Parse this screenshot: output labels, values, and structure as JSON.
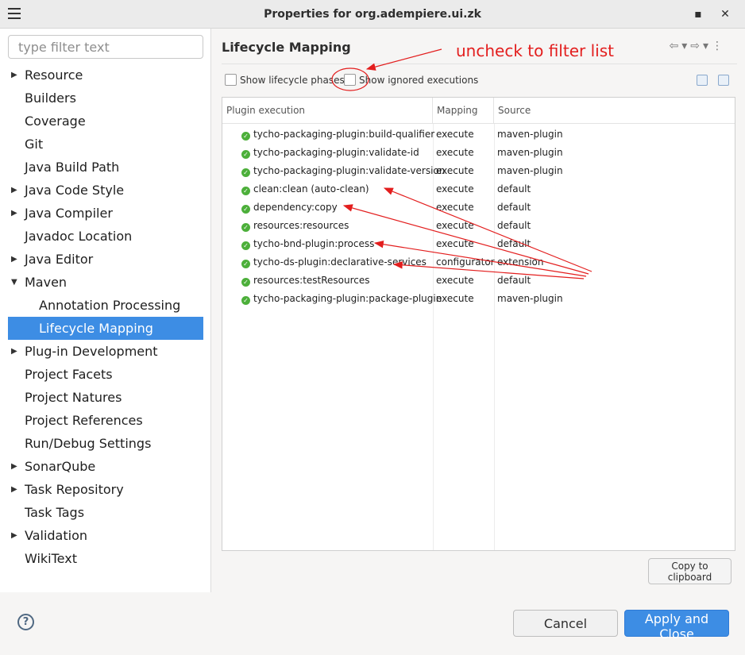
{
  "window": {
    "title": "Properties for org.adempiere.ui.zk"
  },
  "filter": {
    "placeholder": "type filter text"
  },
  "tree": {
    "items": [
      {
        "label": "Resource",
        "arrow": "right",
        "indent": 0
      },
      {
        "label": "Builders",
        "arrow": "",
        "indent": 0
      },
      {
        "label": "Coverage",
        "arrow": "",
        "indent": 0
      },
      {
        "label": "Git",
        "arrow": "",
        "indent": 0
      },
      {
        "label": "Java Build Path",
        "arrow": "",
        "indent": 0
      },
      {
        "label": "Java Code Style",
        "arrow": "right",
        "indent": 0
      },
      {
        "label": "Java Compiler",
        "arrow": "right",
        "indent": 0
      },
      {
        "label": "Javadoc Location",
        "arrow": "",
        "indent": 0
      },
      {
        "label": "Java Editor",
        "arrow": "right",
        "indent": 0
      },
      {
        "label": "Maven",
        "arrow": "down",
        "indent": 0
      },
      {
        "label": "Annotation Processing",
        "arrow": "",
        "indent": 1
      },
      {
        "label": "Lifecycle Mapping",
        "arrow": "",
        "indent": 1,
        "selected": true
      },
      {
        "label": "Plug-in Development",
        "arrow": "right",
        "indent": 0
      },
      {
        "label": "Project Facets",
        "arrow": "",
        "indent": 0
      },
      {
        "label": "Project Natures",
        "arrow": "",
        "indent": 0
      },
      {
        "label": "Project References",
        "arrow": "",
        "indent": 0
      },
      {
        "label": "Run/Debug Settings",
        "arrow": "",
        "indent": 0
      },
      {
        "label": "SonarQube",
        "arrow": "right",
        "indent": 0
      },
      {
        "label": "Task Repository",
        "arrow": "right",
        "indent": 0
      },
      {
        "label": "Task Tags",
        "arrow": "",
        "indent": 0
      },
      {
        "label": "Validation",
        "arrow": "right",
        "indent": 0
      },
      {
        "label": "WikiText",
        "arrow": "",
        "indent": 0
      }
    ]
  },
  "page": {
    "title": "Lifecycle Mapping",
    "show_lifecycle_phases_label": "Show lifecycle phases",
    "show_ignored_executions_label": "Show ignored executions"
  },
  "table": {
    "headers": {
      "plugin": "Plugin execution",
      "mapping": "Mapping",
      "source": "Source"
    },
    "rows": [
      {
        "plugin": "tycho-packaging-plugin:build-qualifier",
        "mapping": "execute",
        "source": "maven-plugin"
      },
      {
        "plugin": "tycho-packaging-plugin:validate-id",
        "mapping": "execute",
        "source": "maven-plugin"
      },
      {
        "plugin": "tycho-packaging-plugin:validate-version",
        "mapping": "execute",
        "source": "maven-plugin"
      },
      {
        "plugin": "clean:clean (auto-clean)",
        "mapping": "execute",
        "source": "default"
      },
      {
        "plugin": "dependency:copy",
        "mapping": "execute",
        "source": "default"
      },
      {
        "plugin": "resources:resources",
        "mapping": "execute",
        "source": "default"
      },
      {
        "plugin": "tycho-bnd-plugin:process",
        "mapping": "execute",
        "source": "default"
      },
      {
        "plugin": "tycho-ds-plugin:declarative-services",
        "mapping": "configurator",
        "source": "extension"
      },
      {
        "plugin": "resources:testResources",
        "mapping": "execute",
        "source": "default"
      },
      {
        "plugin": "tycho-packaging-plugin:package-plugin",
        "mapping": "execute",
        "source": "maven-plugin"
      }
    ]
  },
  "buttons": {
    "copy": "Copy to clipboard",
    "cancel": "Cancel",
    "apply": "Apply and Close",
    "help": "?"
  },
  "annotation": {
    "text": "uncheck to filter list",
    "color": "#e31e1e"
  },
  "colors": {
    "selection": "#3d8de4",
    "status_ok": "#4caf3a"
  }
}
